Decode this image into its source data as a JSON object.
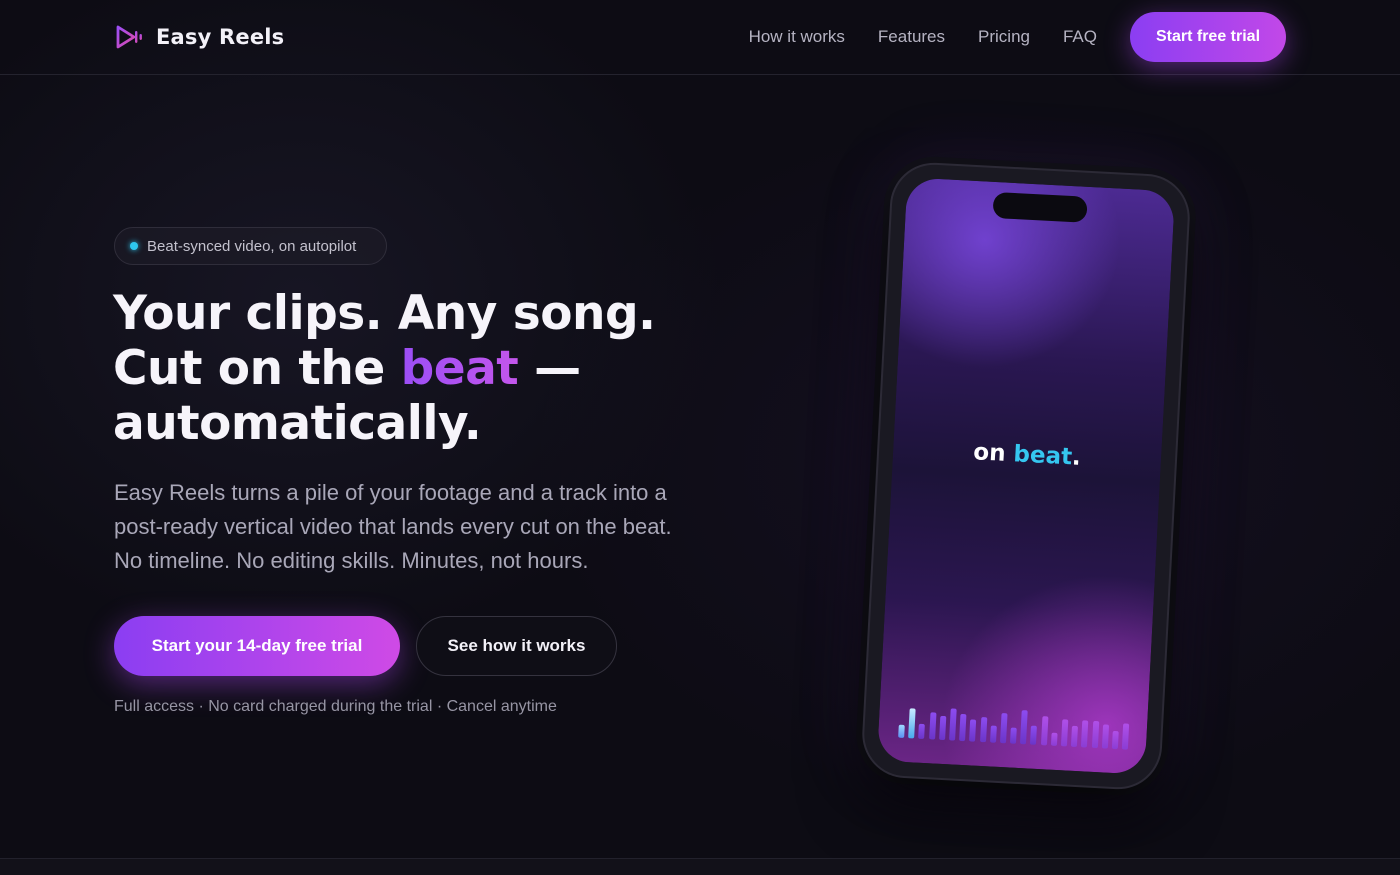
{
  "nav": {
    "brand": "Easy Reels",
    "links": [
      "How it works",
      "Features",
      "Pricing",
      "FAQ"
    ],
    "cta": "Start free trial"
  },
  "hero": {
    "badge": "Beat-synced video, on autopilot",
    "headline": {
      "line1": "Your clips. Any song.",
      "line2_prefix": "Cut on the ",
      "line2_accent": "beat",
      "line2_suffix": " —",
      "line3": "automatically."
    },
    "subhead": {
      "line1": "Easy Reels turns a pile of your footage and a track into a",
      "line2": "post-ready vertical video that lands every cut on the beat.",
      "line3": "No timeline. No editing skills. Minutes, not hours."
    },
    "primary_cta": "Start your 14-day free trial",
    "secondary_cta": "See how it works",
    "fineprint": "Full access · No card charged during the trial · Cancel anytime"
  },
  "phone": {
    "caption_prefix": "on ",
    "caption_accent": "beat",
    "caption_suffix": ".",
    "equalizer_levels": [
      0.35,
      0.8,
      0.4,
      0.7,
      0.62,
      0.85,
      0.72,
      0.58,
      0.66,
      0.45,
      0.8,
      0.42,
      0.9,
      0.5,
      0.75,
      0.35,
      0.7,
      0.55,
      0.72,
      0.7,
      0.62,
      0.48,
      0.68
    ]
  },
  "colors": {
    "accent_start": "#8b3ef2",
    "accent_end": "#c248e8",
    "cyan": "#2ec8ee",
    "background": "#0d0c14"
  }
}
